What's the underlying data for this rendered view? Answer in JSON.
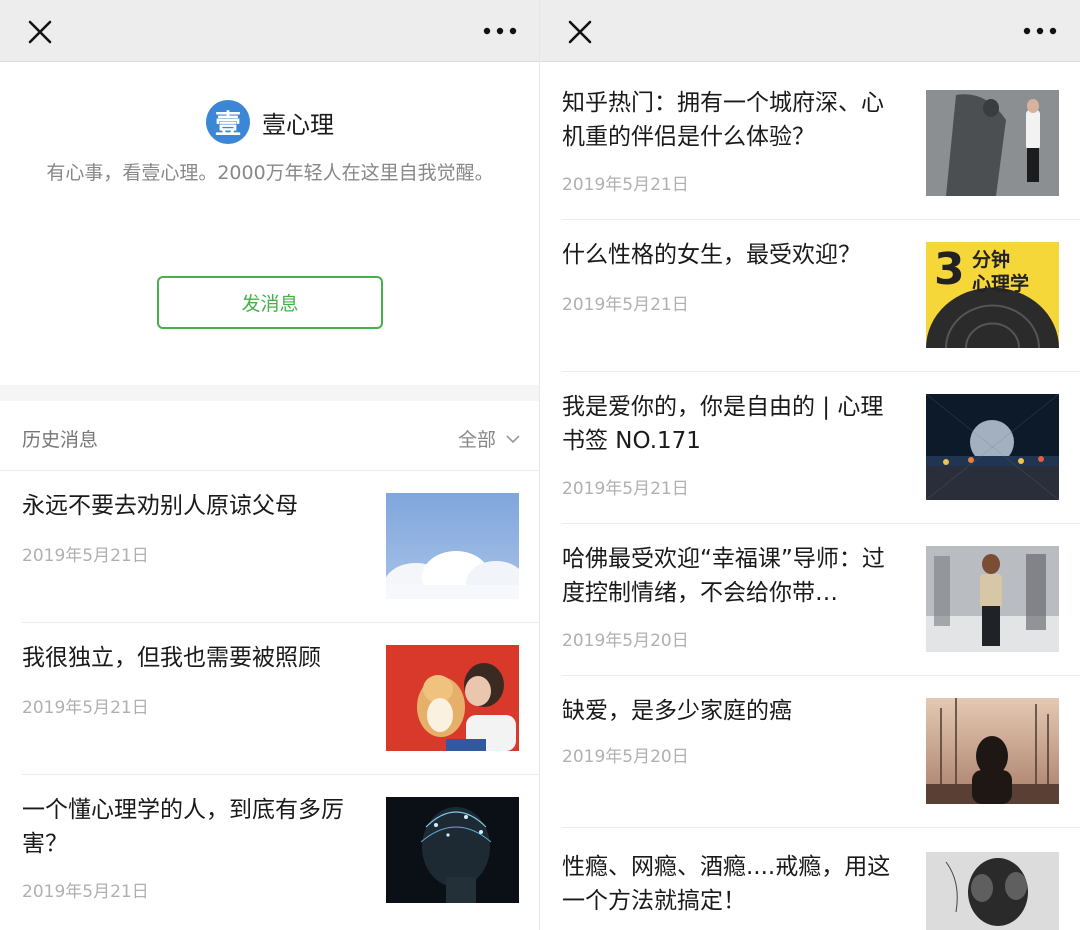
{
  "left": {
    "brand": {
      "avatar_char": "壹",
      "name": "壹心理"
    },
    "description": "有心事，看壹心理。2000万年轻人在这里自我觉醒。",
    "send_button": "发消息",
    "history": {
      "label": "历史消息",
      "filter": "全部"
    },
    "articles": [
      {
        "title": "永远不要去劝别人原谅父母",
        "date": "2019年5月21日",
        "thumb": "clouds-image"
      },
      {
        "title": "我很独立，但我也需要被照顾",
        "date": "2019年5月21日",
        "thumb": "woman-dog-image"
      },
      {
        "title": "一个懂心理学的人，到底有多厉害？",
        "date": "2019年5月21日",
        "thumb": "neural-head-image"
      }
    ]
  },
  "right": {
    "articles": [
      {
        "title": "知乎热门：拥有一个城府深、心机重的伴侣是什么体验？",
        "date": "2019年5月21日",
        "thumb": "shadow-hero-image"
      },
      {
        "title": "什么性格的女生，最受欢迎？",
        "date": "2019年5月21日",
        "thumb": "3-minute-psychology-image",
        "thumb_text_big": "3",
        "thumb_text": "分钟\n心理学"
      },
      {
        "title": "我是爱你的，你是自由的 | 心理书签 NO.171",
        "date": "2019年5月21日",
        "thumb": "city-night-image"
      },
      {
        "title": "哈佛最受欢迎“幸福课”导师：过度控制情绪，不会给你带…",
        "date": "2019年5月20日",
        "thumb": "crowd-woman-image"
      },
      {
        "title": "缺爱，是多少家庭的癌",
        "date": "2019年5月20日",
        "thumb": "harbor-silhouette-image"
      },
      {
        "title": "性瘾、网瘾、酒瘾....戒瘾，用这一个方法就搞定！",
        "date": "",
        "thumb": "head-hands-image"
      }
    ]
  }
}
